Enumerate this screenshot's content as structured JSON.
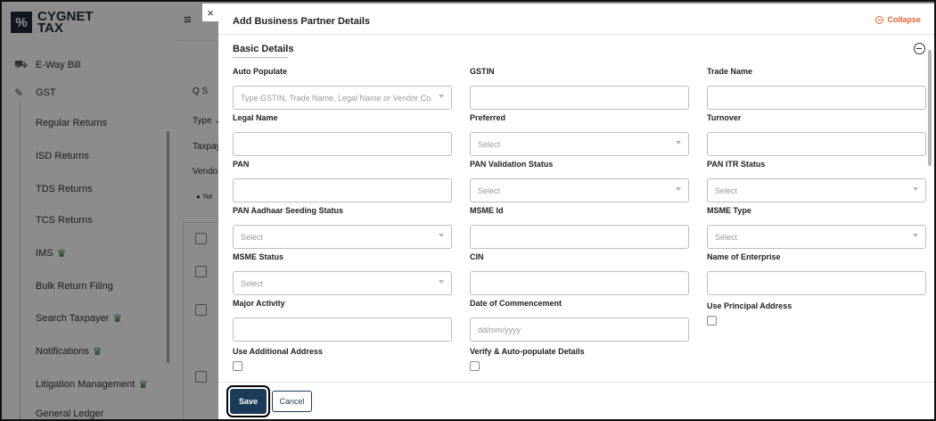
{
  "app": {
    "logo_top": "CYGNET",
    "logo_bottom": "TAX",
    "nav": {
      "eway_bill": "E-Way Bill",
      "gst": "GST",
      "items": [
        {
          "label": "Regular Returns",
          "crown": false
        },
        {
          "label": "ISD Returns",
          "crown": false
        },
        {
          "label": "TDS Returns",
          "crown": false
        },
        {
          "label": "TCS Returns",
          "crown": false
        },
        {
          "label": "IMS",
          "crown": true
        },
        {
          "label": "Bulk Return Filing",
          "crown": false
        },
        {
          "label": "Search Taxpayer",
          "crown": true
        },
        {
          "label": "Notifications",
          "crown": true
        },
        {
          "label": "Litigation Management",
          "crown": true
        },
        {
          "label": "General Ledger",
          "crown": false
        }
      ]
    },
    "background_fragments": {
      "search": "Q  S",
      "type": "Type ⌄",
      "taxpayer": "Taxpay",
      "vendor": "Vendor",
      "yet": "● Yet"
    }
  },
  "drawer": {
    "close_glyph": "×",
    "title": "Add Business Partner Details",
    "collapse_label": "Collapse",
    "section_title": "Basic Details",
    "fields": {
      "auto_populate": {
        "label": "Auto Populate",
        "placeholder": "Type GSTIN, Trade Name, Legal Name or Vendor Co..."
      },
      "gstin": {
        "label": "GSTIN",
        "value": ""
      },
      "trade_name": {
        "label": "Trade Name",
        "value": ""
      },
      "legal_name": {
        "label": "Legal Name",
        "value": ""
      },
      "preferred": {
        "label": "Preferred",
        "placeholder": "Select"
      },
      "turnover": {
        "label": "Turnover",
        "value": ""
      },
      "pan": {
        "label": "PAN",
        "value": ""
      },
      "pan_validation_status": {
        "label": "PAN Validation Status",
        "placeholder": "Select"
      },
      "pan_itr_status": {
        "label": "PAN ITR Status",
        "placeholder": "Select"
      },
      "pan_aadhaar_seeding_status": {
        "label": "PAN Aadhaar Seeding Status",
        "placeholder": "Select"
      },
      "msme_id": {
        "label": "MSME Id",
        "value": ""
      },
      "msme_type": {
        "label": "MSME Type",
        "placeholder": "Select"
      },
      "msme_status": {
        "label": "MSME Status",
        "placeholder": "Select"
      },
      "cin": {
        "label": "CIN",
        "value": ""
      },
      "name_of_enterprise": {
        "label": "Name of Enterprise",
        "value": ""
      },
      "major_activity": {
        "label": "Major Activity",
        "value": ""
      },
      "date_of_commencement": {
        "label": "Date of Commencement",
        "placeholder": "dd/mm/yyyy"
      },
      "use_principal_address": {
        "label": "Use Principal Address",
        "checked": false
      },
      "use_additional_address": {
        "label": "Use Additional Address",
        "checked": false
      },
      "verify_auto_populate": {
        "label": "Verify & Auto-populate Details",
        "checked": false
      }
    },
    "save_label": "Save",
    "cancel_label": "Cancel"
  },
  "colors": {
    "brand_dark": "#1c3b58",
    "collapse_accent": "#e8622c",
    "premium_crown": "#2e8b3a"
  }
}
